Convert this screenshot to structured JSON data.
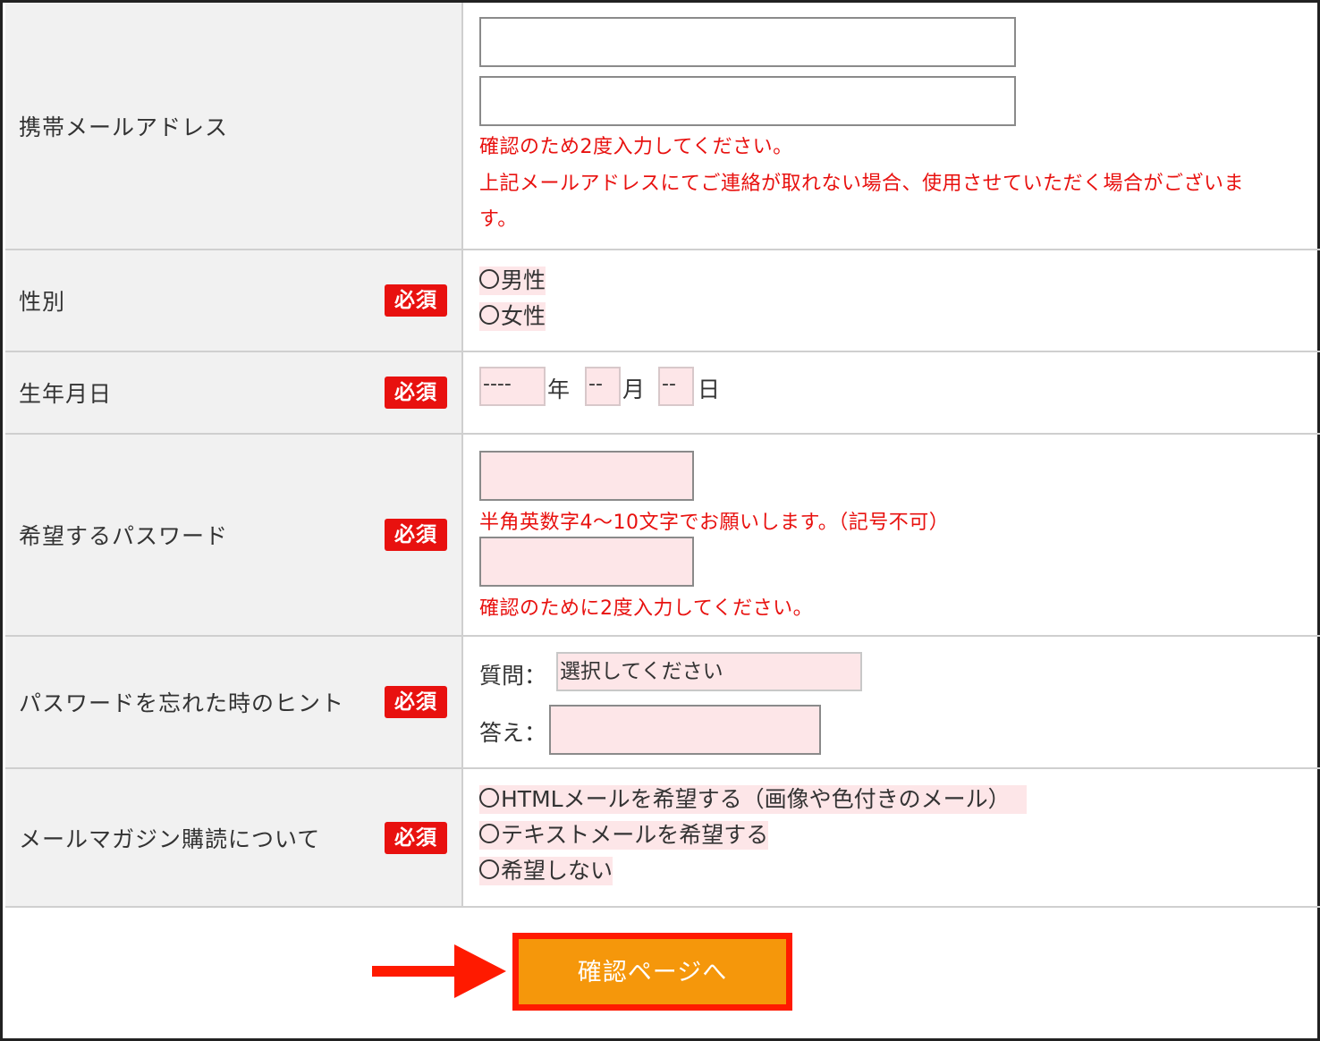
{
  "colors": {
    "required_badge": "#e8110f",
    "note_text": "#e8110f",
    "field_bg": "#fde6e8",
    "label_bg": "#f1f1f1",
    "submit_bg": "#f5970b",
    "highlight": "#ff1a00"
  },
  "required_badge": "必須",
  "mobile_email": {
    "label": "携帯メールアドレス",
    "input_value": "",
    "confirm_value": "",
    "note1": "確認のため2度入力してください。",
    "note2_line1": "上記メールアドレスにてご連絡が取れない場合、使用させていただく場合がございま",
    "note2_line2": "す。"
  },
  "gender": {
    "label": "性別",
    "options": [
      "男性",
      "女性"
    ]
  },
  "birthdate": {
    "label": "生年月日",
    "year_value": "----",
    "year_unit": "年",
    "month_value": "--",
    "month_unit": "月",
    "day_value": "--",
    "day_unit": "日"
  },
  "password": {
    "label": "希望するパスワード",
    "note1": "半角英数字4〜10文字でお願いします。（記号不可）",
    "note2": "確認のために2度入力してください。"
  },
  "hint": {
    "label": "パスワードを忘れた時のヒント",
    "question_label": "質問：",
    "question_value": "選択してください",
    "answer_label": "答え："
  },
  "newsletter": {
    "label": "メールマガジン購読について",
    "options": [
      "HTMLメールを希望する（画像や色付きのメール）",
      "テキストメールを希望する",
      "希望しない"
    ]
  },
  "submit_label": "確認ページへ"
}
